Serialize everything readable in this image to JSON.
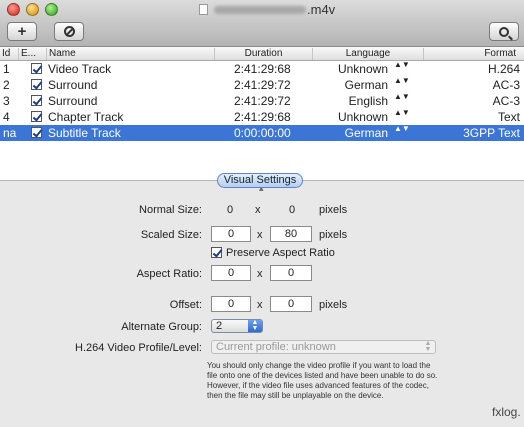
{
  "window": {
    "title_suffix": ".m4v",
    "toolbar": {
      "add_label": "+"
    }
  },
  "table": {
    "headers": [
      "Id",
      "E...",
      "Name",
      "Duration",
      "Language",
      "Format"
    ],
    "rows": [
      {
        "id": "1",
        "name": "Video Track",
        "duration": "2:41:29:68",
        "language": "Unknown",
        "format": "H.264",
        "enabled": true
      },
      {
        "id": "2",
        "name": "Surround",
        "duration": "2:41:29:72",
        "language": "German",
        "format": "AC-3",
        "enabled": true
      },
      {
        "id": "3",
        "name": "Surround",
        "duration": "2:41:29:72",
        "language": "English",
        "format": "AC-3",
        "enabled": true
      },
      {
        "id": "4",
        "name": "Chapter Track",
        "duration": "2:41:29:68",
        "language": "Unknown",
        "format": "Text",
        "enabled": true
      },
      {
        "id": "na",
        "name": "Subtitle Track",
        "duration": "0:00:00:00",
        "language": "German",
        "format": "3GPP Text",
        "enabled": true,
        "selected": true
      }
    ],
    "updown_glyph": "▲▼"
  },
  "settings": {
    "tab_label": "Visual Settings",
    "normal_size": {
      "label": "Normal Size:",
      "w": "0",
      "x": "x",
      "h": "0",
      "unit": "pixels"
    },
    "scaled_size": {
      "label": "Scaled Size:",
      "w": "0",
      "x": "x",
      "h": "80",
      "unit": "pixels"
    },
    "preserve_aspect": {
      "label": "Preserve Aspect Ratio",
      "checked": true
    },
    "aspect_ratio": {
      "label": "Aspect Ratio:",
      "a": "0",
      "x": "x",
      "b": "0"
    },
    "offset": {
      "label": "Offset:",
      "a": "0",
      "x": "x",
      "b": "0",
      "unit": "pixels"
    },
    "alternate_group": {
      "label": "Alternate Group:",
      "value": "2"
    },
    "h264_profile": {
      "label": "H.264 Video Profile/Level:",
      "value": "Current profile: unknown"
    },
    "note": "You should only change the video profile if you want to load the file onto one of the devices listed and have been unable to do so. However, if the video file uses advanced features of the codec, then the file may still be unplayable on the device."
  },
  "watermark": "fxlog."
}
